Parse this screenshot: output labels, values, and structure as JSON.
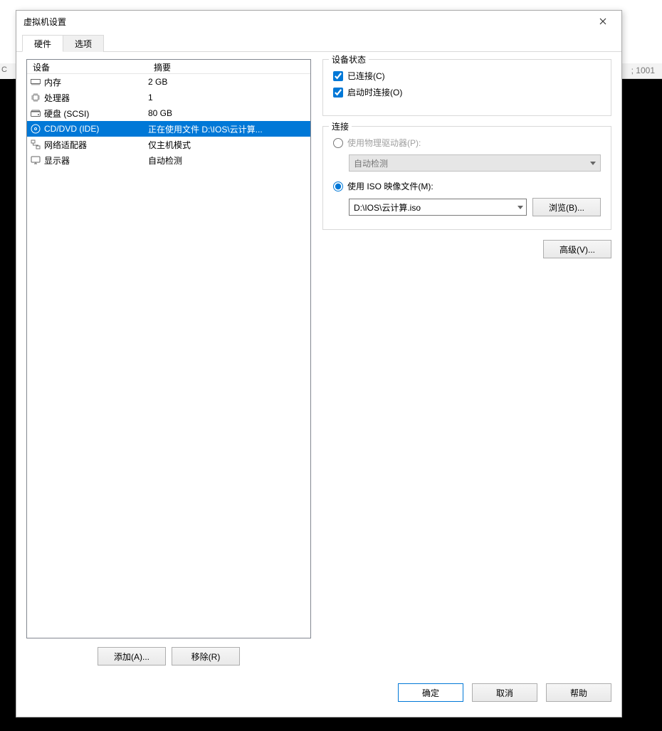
{
  "browser": {
    "partial_text": "; 1001",
    "left_text": "C"
  },
  "dialog": {
    "title": "虚拟机设置",
    "tabs": {
      "hardware": "硬件",
      "options": "选项"
    },
    "columns": {
      "device": "设备",
      "summary": "摘要"
    },
    "devices": [
      {
        "icon": "memory-icon",
        "name": "内存",
        "summary": "2 GB",
        "selected": false
      },
      {
        "icon": "cpu-icon",
        "name": "处理器",
        "summary": "1",
        "selected": false
      },
      {
        "icon": "disk-icon",
        "name": "硬盘 (SCSI)",
        "summary": "80 GB",
        "selected": false
      },
      {
        "icon": "cd-icon",
        "name": "CD/DVD (IDE)",
        "summary": "正在使用文件 D:\\IOS\\云计算...",
        "selected": true
      },
      {
        "icon": "network-icon",
        "name": "网络适配器",
        "summary": "仅主机模式",
        "selected": false
      },
      {
        "icon": "display-icon",
        "name": "显示器",
        "summary": "自动检测",
        "selected": false
      }
    ],
    "buttons": {
      "add": "添加(A)...",
      "remove": "移除(R)"
    },
    "right": {
      "device_status": {
        "title": "设备状态",
        "connected": "已连接(C)",
        "connect_at_power_on": "启动时连接(O)"
      },
      "connection": {
        "title": "连接",
        "use_physical": "使用物理驱动器(P):",
        "auto_detect": "自动检测",
        "use_iso": "使用 ISO 映像文件(M):",
        "iso_path": "D:\\IOS\\云计算.iso",
        "browse": "浏览(B)..."
      },
      "advanced": "高级(V)..."
    },
    "footer": {
      "ok": "确定",
      "cancel": "取消",
      "help": "帮助"
    }
  }
}
